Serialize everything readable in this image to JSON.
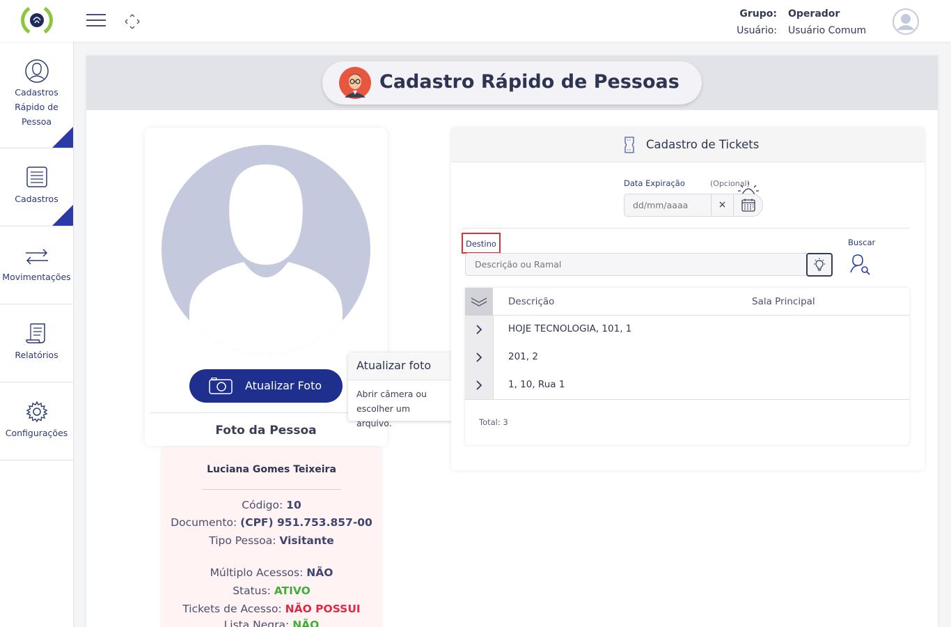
{
  "header": {
    "group_label": "Grupo:",
    "group_value": "Operador",
    "user_label": "Usuário:",
    "user_value": "Usuário Comum"
  },
  "sidebar": {
    "items": [
      {
        "label": "Cadastros Rápido de Pessoa",
        "icon": "person-circle-icon"
      },
      {
        "label": "Cadastros",
        "icon": "document-list-icon"
      },
      {
        "label": "Movimentações",
        "icon": "arrows-exchange-icon"
      },
      {
        "label": "Relatórios",
        "icon": "report-scroll-icon"
      },
      {
        "label": "Configurações",
        "icon": "gear-icon"
      }
    ]
  },
  "page": {
    "title": "Cadastro Rápido de Pessoas"
  },
  "photo": {
    "button_label": "Atualizar Foto",
    "caption": "Foto da Pessoa",
    "tooltip_title": "Atualizar foto",
    "tooltip_body": "Abrir câmera ou escolher um arquivo."
  },
  "person": {
    "name": "Luciana Gomes Teixeira",
    "codigo_label": "Código:",
    "codigo_value": "10",
    "documento_label": "Documento:",
    "documento_value": "(CPF) 951.753.857-00",
    "tipo_label": "Tipo Pessoa:",
    "tipo_value": "Visitante",
    "multiplo_label": "Múltiplo Acessos:",
    "multiplo_value": "NÃO",
    "status_label": "Status:",
    "status_value": "ATIVO",
    "tickets_label": "Tickets de Acesso:",
    "tickets_value": "NÃO POSSUI",
    "lista_label": "Lista Negra:",
    "lista_value": "NÃO"
  },
  "tickets": {
    "title": "Cadastro de Tickets",
    "expiracao_label": "Data Expiração",
    "opcional_label": "(Opcional)",
    "date_placeholder": "dd/mm/aaaa",
    "clear_label": "×",
    "destino_label": "Destino",
    "destino_placeholder": "Descrição ou Ramal",
    "buscar_label": "Buscar",
    "columns": [
      "Descrição",
      "Sala Principal"
    ],
    "rows": [
      {
        "descricao": "HOJE TECNOLOGIA, 101, 1",
        "sala": ""
      },
      {
        "descricao": "201, 2",
        "sala": ""
      },
      {
        "descricao": "1, 10, Rua 1",
        "sala": ""
      }
    ],
    "total": "Total: 3"
  },
  "colors": {
    "primary": "#1f2f8d",
    "accent_corner": "#2b3aa6",
    "green": "#3fae3a",
    "red": "#e02a45",
    "logo_green": "#8cc63f"
  }
}
